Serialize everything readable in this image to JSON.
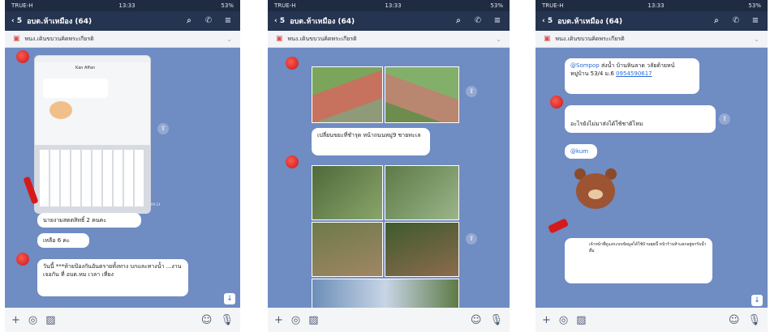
{
  "status": {
    "carrier": "TRUE-H",
    "time": "13:33",
    "battery": "53%"
  },
  "header": {
    "back_count": "5",
    "title": "อบต.ห้าเหมือง (64)"
  },
  "pinned": {
    "text": "พนง.เดินขบวนคิดพระเกียรติ"
  },
  "phone1": {
    "inner_contact": "Kan Affan",
    "msg1": "นายงามสตตสิทธิ์ 2 คนคะ",
    "msg2": "เหลือ 6 คะ",
    "msg3": "วันนี้ ***ท้ายป้องกันอันตรายทั้งทาง บกและทางน้ำ ...งาน เจอกัน ที่ อบต.หม เวลา เที่ยง"
  },
  "phone2": {
    "msg1": "เปลี่ยนขยะที่ชำรุด หน้าถนนหมู่9 ชายทะเล"
  },
  "phone3": {
    "mention": "@Sompop",
    "msg1": "ส่งน้ำ บ้านหินลาด วลัยด้ายหน์ หมู่บ้าน 53/4 ม.6",
    "phone_number": "0954590617",
    "msg2": "อะไรยังไม่มาส่งได้ใช้ชาติไหม",
    "mention2": "@kum",
    "msg3": "เจ้าหน้าที่ดูแลระบบข้อมูลได้ใช้บ้านพุธนี้ หน้าร้านห้าแยกอยู่ยกรับน้ำดื่ม"
  }
}
